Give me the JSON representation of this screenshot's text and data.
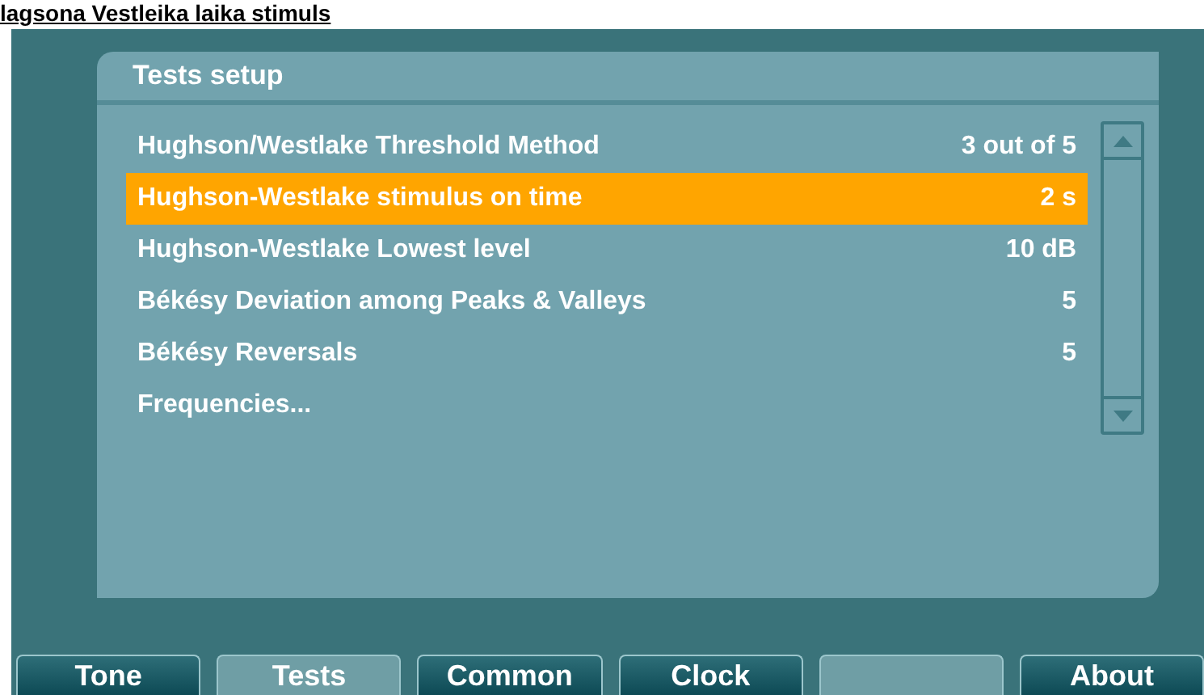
{
  "caption": "lagsona Vestleika laika stimuls",
  "panel": {
    "title": "Tests setup",
    "rows": [
      {
        "label": "Hughson/Westlake Threshold Method",
        "value": "3 out of 5",
        "selected": false
      },
      {
        "label": "Hughson-Westlake stimulus on time",
        "value": "2 s",
        "selected": true
      },
      {
        "label": "Hughson-Westlake Lowest level",
        "value": "10 dB",
        "selected": false
      },
      {
        "label": "Békésy Deviation among Peaks & Valleys",
        "value": "5",
        "selected": false
      },
      {
        "label": "Békésy Reversals",
        "value": "5",
        "selected": false
      },
      {
        "label": "Frequencies...",
        "selected": false
      }
    ]
  },
  "tabs": [
    {
      "kind": "tab",
      "label": "Tone",
      "selected": false
    },
    {
      "kind": "tab",
      "label": "Tests",
      "selected": true
    },
    {
      "kind": "tab",
      "label": "Common",
      "selected": false
    },
    {
      "kind": "tab",
      "label": "Clock",
      "selected": false
    },
    {
      "kind": "blank"
    },
    {
      "kind": "tab",
      "label": "About",
      "selected": false
    }
  ]
}
